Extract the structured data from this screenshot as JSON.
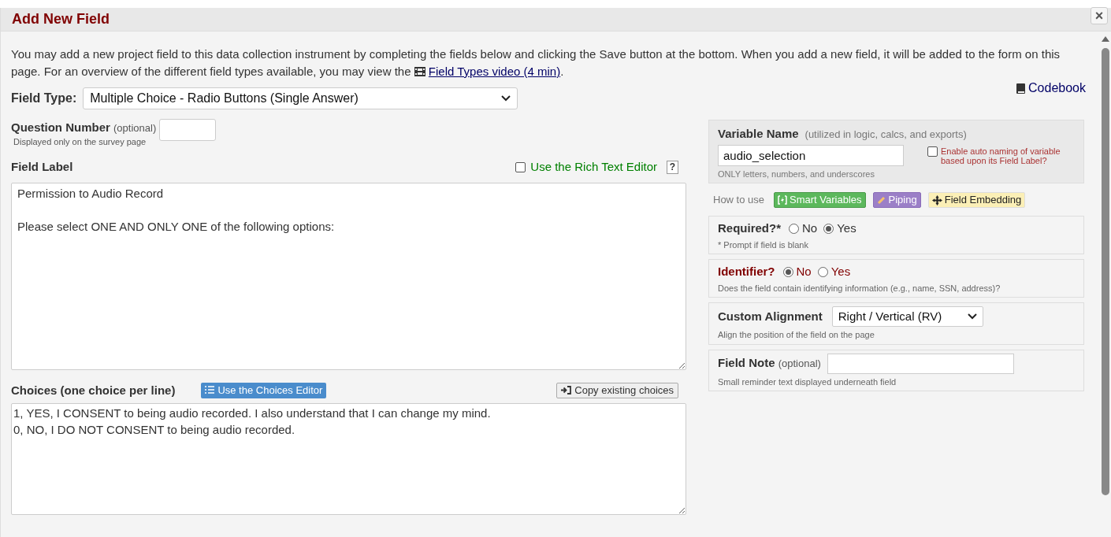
{
  "dialog": {
    "title": "Add New Field",
    "close": "×"
  },
  "intro": {
    "text": "You may add a new project field to this data collection instrument by completing the fields below and clicking the Save button at the bottom. When you add a new field, it will be added to the form on this page. For an overview of the different field types available, you may view the",
    "link": "Field Types video (4 min)",
    "after": "."
  },
  "field_type": {
    "label": "Field Type:",
    "value": "Multiple Choice - Radio Buttons (Single Answer)"
  },
  "codebook": "Codebook",
  "question_number": {
    "label": "Question Number",
    "optional": "(optional)",
    "hint": "Displayed only on the survey page"
  },
  "field_label": {
    "label": "Field Label",
    "rich_text": {
      "label": "Use the Rich Text Editor",
      "checked": false
    },
    "help": "?",
    "value": "Permission to Audio Record\n\nPlease select ONE AND ONLY ONE of the following options:"
  },
  "choices": {
    "label": "Choices (one choice per line)",
    "editor_button": "Use the Choices Editor",
    "copy_button": "Copy existing choices",
    "value": "1, YES, I CONSENT to being audio recorded. I also understand that I can change my mind.\n0, NO, I DO NOT CONSENT to being audio recorded."
  },
  "variable_name": {
    "label": "Variable Name",
    "note": "(utilized in logic, calcs, and exports)",
    "value": "audio_selection",
    "hint": "ONLY letters, numbers, and underscores",
    "auto_naming": {
      "label": "Enable auto naming of variable based upon its Field Label?",
      "checked": false
    }
  },
  "how_to_use": {
    "label": "How to use",
    "badges": [
      {
        "kind": "smart",
        "label": "Smart Variables"
      },
      {
        "kind": "piping",
        "label": "Piping"
      },
      {
        "kind": "embedding",
        "label": "Field Embedding"
      }
    ]
  },
  "required": {
    "label": "Required?*",
    "hint": "* Prompt if field is blank",
    "options": [
      {
        "label": "No",
        "selected": false
      },
      {
        "label": "Yes",
        "selected": true
      }
    ]
  },
  "identifier": {
    "label": "Identifier?",
    "hint": "Does the field contain identifying information (e.g., name, SSN, address)?",
    "options": [
      {
        "label": "No",
        "selected": true
      },
      {
        "label": "Yes",
        "selected": false
      }
    ]
  },
  "custom_alignment": {
    "label": "Custom Alignment",
    "value": "Right / Vertical (RV)",
    "hint": "Align the position of the field on the page"
  },
  "field_note": {
    "label": "Field Note",
    "optional": "(optional)",
    "hint": "Small reminder text displayed underneath field"
  }
}
